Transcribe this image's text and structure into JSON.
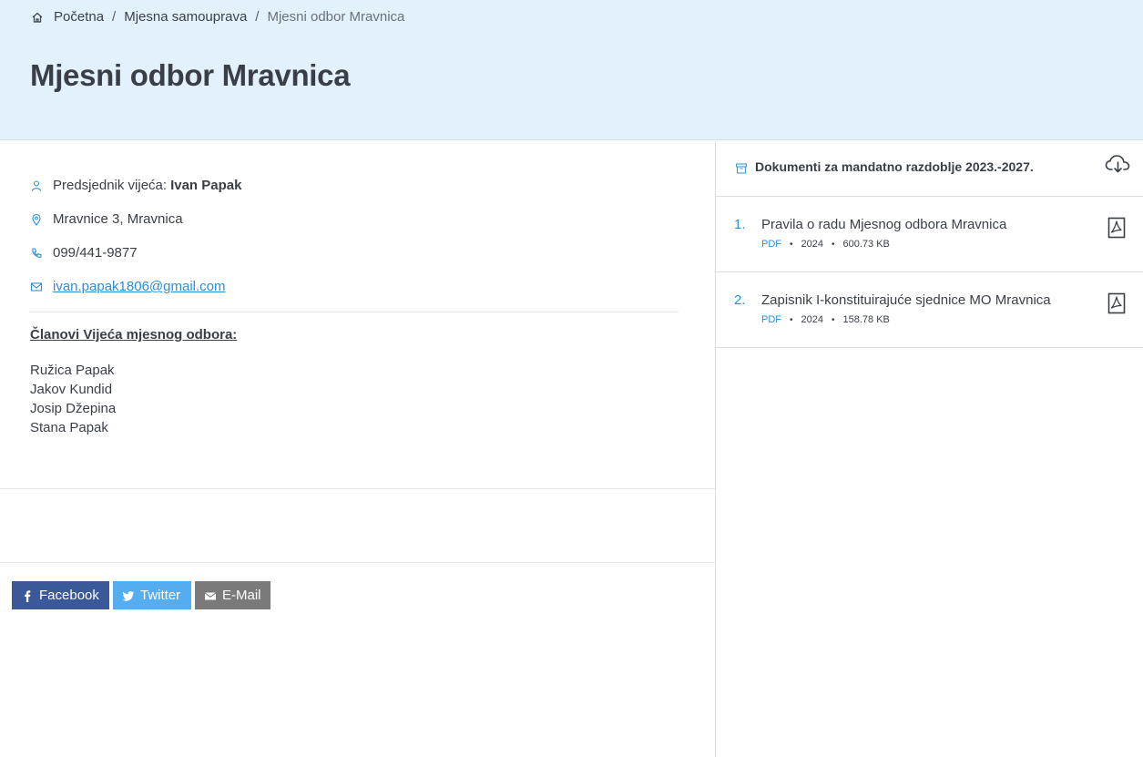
{
  "breadcrumb": {
    "home": "Početna",
    "parent": "Mjesna samouprava",
    "current": "Mjesni odbor Mravnica",
    "separator": "/"
  },
  "page": {
    "title": "Mjesni odbor Mravnica"
  },
  "contact": {
    "president_label": "Predsjednik vijeća:",
    "president_name": "Ivan Papak",
    "address": "Mravnice 3, Mravnica",
    "phone": "099/441-9877",
    "email": "ivan.papak1806@gmail.com"
  },
  "members": {
    "title": "Članovi Vijeća mjesnog odbora:",
    "list": [
      "Ružica Papak",
      "Jakov Kundid",
      "Josip Džepina",
      "Stana Papak"
    ]
  },
  "share": {
    "facebook": "Facebook",
    "twitter": "Twitter",
    "email": "E-Mail"
  },
  "documents": {
    "title": "Dokumenti za mandatno razdoblje 2023.-2027.",
    "items": [
      {
        "num": "1.",
        "title": "Pravila o radu Mjesnog odbora Mravnica",
        "type": "PDF",
        "year": "2024",
        "size": "600.73 KB"
      },
      {
        "num": "2.",
        "title": "Zapisnik I-konstituirajuće sjednice MO Mravnica",
        "type": "PDF",
        "year": "2024",
        "size": "158.78 KB"
      }
    ]
  },
  "colors": {
    "hero_bg": "#e3f1fc",
    "accent": "#2a8fd6",
    "facebook": "#3b5998",
    "twitter": "#55acee",
    "email_btn": "#7a7a7a"
  }
}
